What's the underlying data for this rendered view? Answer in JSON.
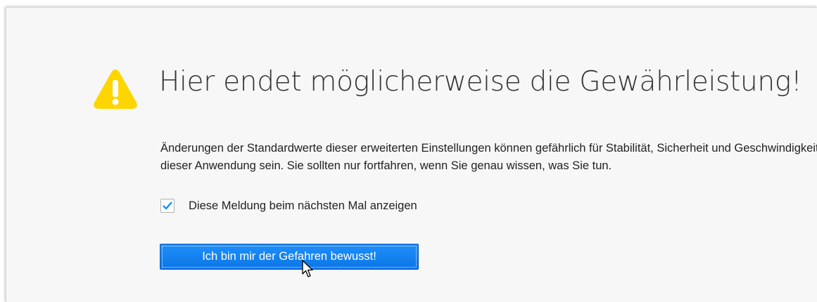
{
  "warning": {
    "title": "Hier endet möglicherweise die Gewährleistung!",
    "description": "Änderungen der Standardwerte dieser erweiterten Einstellungen können gefährlich für Stabilität, Sicherheit und Geschwindigkeit dieser Anwendung sein. Sie sollten nur fortfahren, wenn Sie genau wissen, was Sie tun.",
    "icon": "warning-triangle-icon",
    "icon_color": "#ffd500"
  },
  "checkbox": {
    "label": "Diese Meldung beim nächsten Mal anzeigen",
    "checked": true,
    "check_color": "#0a84ff"
  },
  "button": {
    "label": "Ich bin mir der Gefahren bewusst!",
    "color": "#0a84ff"
  }
}
